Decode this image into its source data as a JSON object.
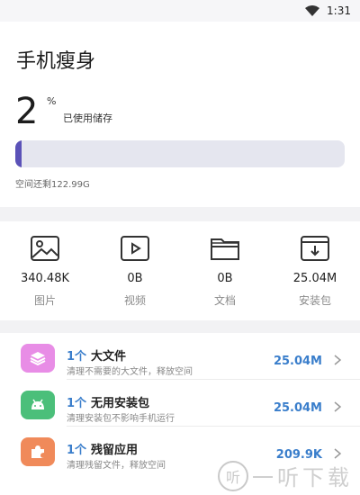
{
  "status_bar": {
    "time": "1:31"
  },
  "header": {
    "title": "手机瘦身"
  },
  "storage": {
    "used_percent": "2",
    "percent_sign": "%",
    "used_label": "已使用储存",
    "fill_fraction": 0.02,
    "remaining_text": "空间还剩122.99G"
  },
  "categories": [
    {
      "icon": "image-icon",
      "size": "340.48K",
      "label": "图片"
    },
    {
      "icon": "video-icon",
      "size": "0B",
      "label": "视频"
    },
    {
      "icon": "folder-icon",
      "size": "0B",
      "label": "文档"
    },
    {
      "icon": "package-icon",
      "size": "25.04M",
      "label": "安装包"
    }
  ],
  "clean_items": [
    {
      "icon": "layers-icon",
      "color": "#e88de6",
      "count": "1个",
      "title": "大文件",
      "desc": "清理不需要的大文件，释放空间",
      "size": "25.04M"
    },
    {
      "icon": "android-icon",
      "color": "#4bbf7a",
      "count": "1个",
      "title": "无用安装包",
      "desc": "清理安装包不影响手机运行",
      "size": "25.04M"
    },
    {
      "icon": "puzzle-icon",
      "color": "#f08a5a",
      "count": "1个",
      "title": "残留应用",
      "desc": "清理残留文件，释放空间",
      "size": "209.9K"
    }
  ],
  "colors": {
    "accent": "#3a7ecb",
    "bar_fill": "#5b52b8",
    "bar_track": "#e5e6ef"
  },
  "watermark": {
    "logo_char": "听",
    "text": "一听下载"
  }
}
